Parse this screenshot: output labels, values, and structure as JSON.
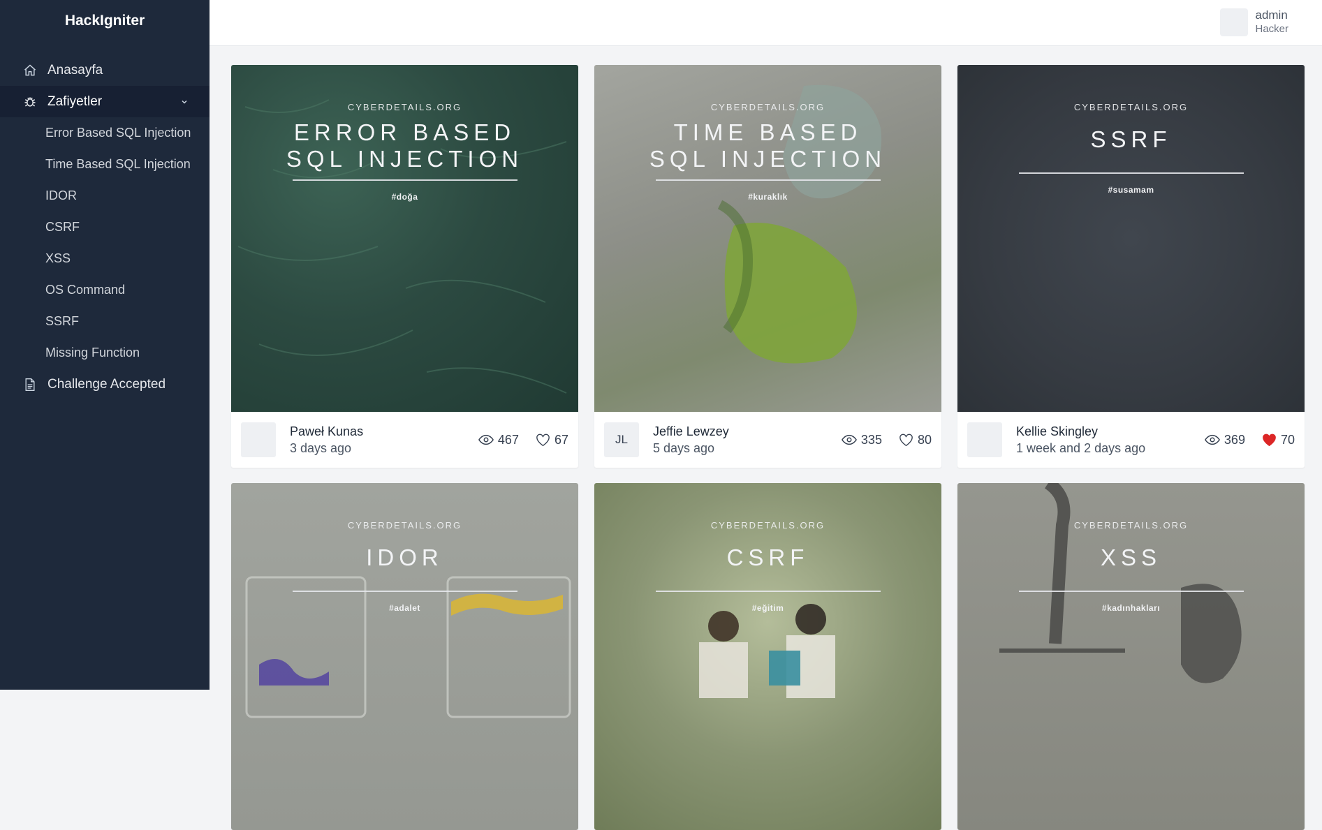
{
  "app": {
    "brand": "HackIgniter"
  },
  "sidebar": {
    "items": [
      {
        "label": "Anasayfa",
        "icon": "home-icon"
      },
      {
        "label": "Zafiyetler",
        "icon": "bug-icon",
        "expanded": true
      },
      {
        "label": "Challenge Accepted",
        "icon": "document-icon"
      }
    ],
    "subitems": [
      {
        "label": "Error Based SQL Injection"
      },
      {
        "label": "Time Based SQL Injection"
      },
      {
        "label": "IDOR"
      },
      {
        "label": "CSRF"
      },
      {
        "label": "XSS"
      },
      {
        "label": "OS Command"
      },
      {
        "label": "SSRF"
      },
      {
        "label": "Missing Function"
      }
    ]
  },
  "header": {
    "user_name": "admin",
    "user_role": "Hacker"
  },
  "cards": [
    {
      "site": "CYBERDETAILS.ORG",
      "title_line1": "ERROR BASED",
      "title_line2": "SQL INJECTION",
      "tag": "#doğa",
      "author": "Paweł Kunas",
      "time": "3 days ago",
      "avatar_text": "",
      "views": "467",
      "likes": "67",
      "liked": false,
      "bg": "#2c4a41"
    },
    {
      "site": "CYBERDETAILS.ORG",
      "title_line1": "TIME BASED",
      "title_line2": "SQL INJECTION",
      "tag": "#kuraklık",
      "author": "Jeffie Lewzey",
      "time": "5 days ago",
      "avatar_text": "JL",
      "views": "335",
      "likes": "80",
      "liked": false,
      "bg": "#8f928c"
    },
    {
      "site": "CYBERDETAILS.ORG",
      "title_line1": "SSRF",
      "title_line2": "",
      "tag": "#susamam",
      "author": "Kellie Skingley",
      "time": "1 week and 2 days ago",
      "avatar_text": "",
      "views": "369",
      "likes": "70",
      "liked": true,
      "bg": "#363b42"
    },
    {
      "site": "CYBERDETAILS.ORG",
      "title_line1": "IDOR",
      "title_line2": "",
      "tag": "#adalet",
      "bg": "#9a9d97"
    },
    {
      "site": "CYBERDETAILS.ORG",
      "title_line1": "CSRF",
      "title_line2": "",
      "tag": "#eğitim",
      "bg": "#8a9574"
    },
    {
      "site": "CYBERDETAILS.ORG",
      "title_line1": "XSS",
      "title_line2": "",
      "tag": "#kadınhakları",
      "bg": "#8c8d8a"
    }
  ],
  "colors": {
    "sidebar": "#1e293b",
    "like_active": "#dc2626"
  }
}
